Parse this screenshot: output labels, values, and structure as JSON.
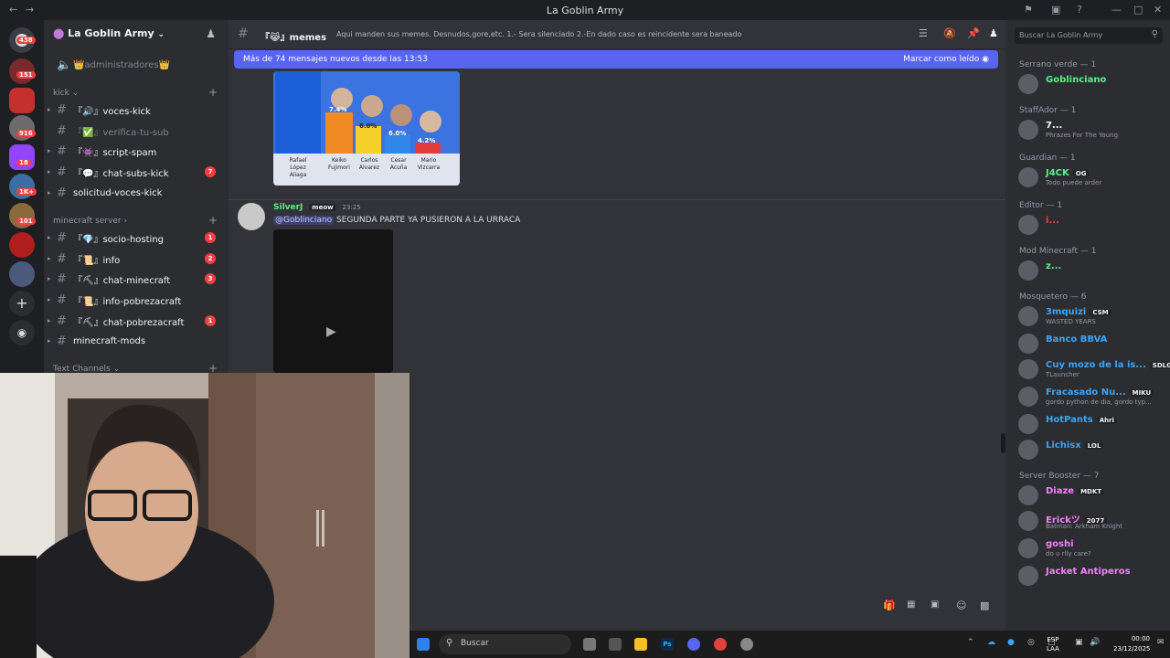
{
  "window": {
    "title": "La Goblin Army"
  },
  "servers": [
    {
      "badge": "438"
    },
    {
      "badge": "151"
    },
    {
      "badge": "916"
    },
    {
      "badge": "18"
    },
    {
      "badge": "1K+"
    },
    {
      "badge": "101"
    }
  ],
  "sidebar": {
    "server_name": "La Goblin Army",
    "admin_label": "👑administradores👑",
    "categories": {
      "kick": "kick",
      "minecraft": "minecraft server",
      "text": "Text Channels"
    },
    "channels": [
      {
        "label": "『🔊』voces-kick",
        "badge": ""
      },
      {
        "label": "『✅』verifica-tu-sub",
        "badge": ""
      },
      {
        "label": "『👾』script-spam",
        "badge": ""
      },
      {
        "label": "『💬』chat-subs-kick",
        "badge": "7"
      },
      {
        "label": "solicitud-voces-kick",
        "badge": ""
      },
      {
        "label": "『💎』socio-hosting",
        "badge": "1"
      },
      {
        "label": "『📜』info",
        "badge": "2"
      },
      {
        "label": "『⛏』chat-minecraft",
        "badge": "3"
      },
      {
        "label": "『📜』info-pobrezacraft",
        "badge": ""
      },
      {
        "label": "『⛏』chat-pobrezacraft",
        "badge": "1"
      },
      {
        "label": "minecraft-mods",
        "badge": ""
      }
    ]
  },
  "chat": {
    "channel_name": "『😹』memes",
    "topic": "Aqui manden sus memes. Desnudos,gore,etc. 1.- Sera silenciado 2.-En dado caso es reincidente sera baneado",
    "search_placeholder": "Buscar La Goblin Army",
    "new_messages": "Más de 74 mensajes nuevos desde las 13:53",
    "mark_read": "Marcar como leído",
    "chart_labels": [
      {
        "name": "Rafael López Aliaga",
        "value": ""
      },
      {
        "name": "Keiko Fujimori",
        "value": "7.4%"
      },
      {
        "name": "Carlos Álvarez",
        "value": "6.0%"
      },
      {
        "name": "Cesar Acuña",
        "value": "6.0%"
      },
      {
        "name": "Mario Vizcarra",
        "value": "4.2%"
      }
    ],
    "message": {
      "author": "SilverJ",
      "author_tag": "meow",
      "time": "23:25",
      "mention": "@Goblinciano",
      "text": " SEGUNDA PARTE YA PUSIERON A LA URRACA"
    }
  },
  "members": {
    "groups": [
      {
        "role": "Serrano verde — 1",
        "items": [
          {
            "name": "Goblinciano",
            "status": "",
            "tag": "",
            "color": "#57f287"
          }
        ]
      },
      {
        "role": "StaffAdor — 1",
        "items": [
          {
            "name": "7...",
            "status": "Phrazes For The Young",
            "tag": "",
            "color": "#ffffff"
          }
        ]
      },
      {
        "role": "Guardian — 1",
        "items": [
          {
            "name": "J4CK",
            "status": "Todo puede arder",
            "tag": "OG",
            "color": "#57f287"
          }
        ]
      },
      {
        "role": "Editor — 1",
        "items": [
          {
            "name": "i...",
            "status": "",
            "tag": "",
            "color": "#f23f43"
          }
        ]
      },
      {
        "role": "Mod Minecraft — 1",
        "items": [
          {
            "name": "z...",
            "status": "",
            "tag": "",
            "color": "#57f287"
          }
        ]
      },
      {
        "role": "Mosquetero — 6",
        "items": [
          {
            "name": "3mquizi",
            "status": "WASTED YEARS",
            "tag": "CSM",
            "color": "#3ba4f7"
          },
          {
            "name": "Banco BBVA",
            "status": "",
            "tag": "",
            "color": "#3ba4f7"
          },
          {
            "name": "Cuy mozo de la is...",
            "status": "TLauncher",
            "tag": "SDLG",
            "color": "#3ba4f7"
          },
          {
            "name": "Fracasado Nu...",
            "status": "gordo python de dia, gordo typ...",
            "tag": "MIKU",
            "color": "#3ba4f7"
          },
          {
            "name": "HotPants",
            "status": "",
            "tag": "Ahri",
            "color": "#3ba4f7"
          },
          {
            "name": "Lichisx",
            "status": "",
            "tag": "LOL",
            "color": "#3ba4f7"
          }
        ]
      },
      {
        "role": "Server Booster — 7",
        "items": [
          {
            "name": "Diaze",
            "status": "",
            "tag": "MDKT",
            "color": "#f47fff"
          },
          {
            "name": "Erickツ",
            "status": "Batman: Arkham Knight",
            "tag": "2077",
            "color": "#f47fff"
          },
          {
            "name": "goshi",
            "status": "do u rlly care?",
            "tag": "",
            "color": "#f47fff"
          },
          {
            "name": "Jacket Antiperos",
            "status": "",
            "tag": "",
            "color": "#f47fff"
          }
        ]
      }
    ]
  },
  "taskbar": {
    "search_label": "Buscar",
    "lang": "ESP",
    "region": "LAA",
    "time": "00:00",
    "date": "23/12/2025"
  },
  "colors": {
    "accent": "#5865f2",
    "online": "#23a55a",
    "badge": "#f23f43"
  }
}
